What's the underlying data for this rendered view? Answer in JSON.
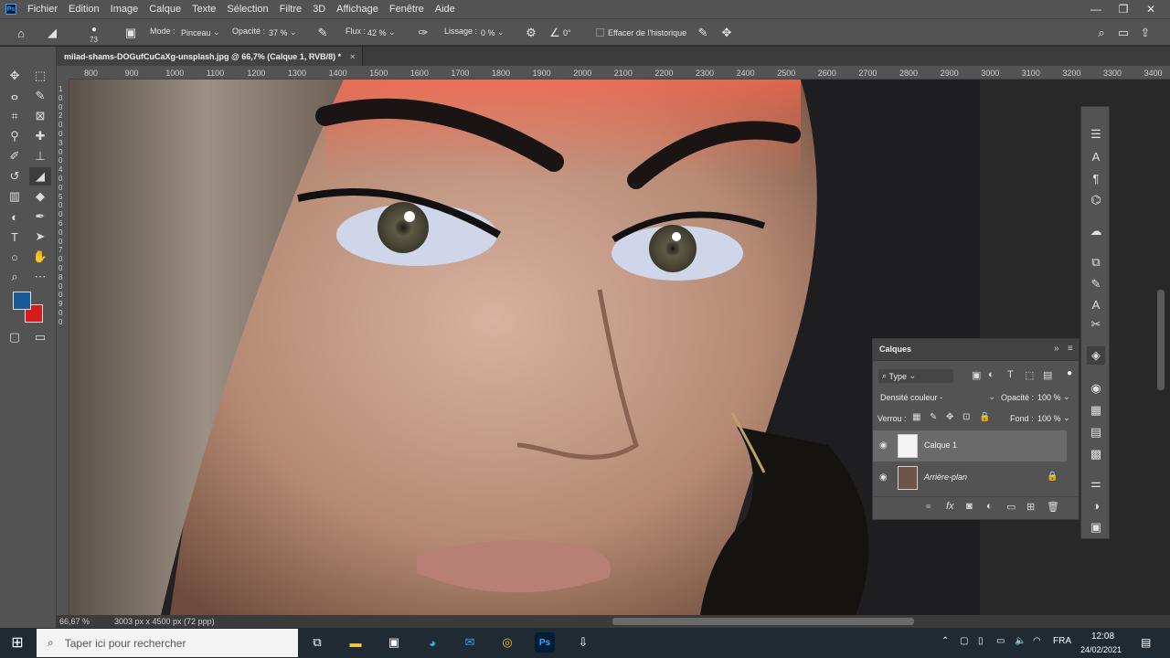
{
  "app": {
    "logo": "Ps"
  },
  "menu": [
    "Fichier",
    "Edition",
    "Image",
    "Calque",
    "Texte",
    "Sélection",
    "Filtre",
    "3D",
    "Affichage",
    "Fenêtre",
    "Aide"
  ],
  "window_controls": {
    "minimize": "—",
    "maximize": "❐",
    "close": "✕"
  },
  "options": {
    "brush_size": "73",
    "mode_label": "Mode :",
    "mode_value": "Pinceau",
    "opacity_label": "Opacité :",
    "opacity_value": "37 %",
    "flux_label": "Flux :",
    "flux_value": "42 %",
    "lissage_label": "Lissage :",
    "lissage_value": "0 %",
    "angle_value": "0°",
    "effacer_label": "Effacer de l'historique"
  },
  "document_tab": {
    "title": "milad-shams-DOGufCuCaXg-unsplash.jpg @ 66,7% (Calque 1, RVB/8) *",
    "close": "×"
  },
  "ruler_h": [
    "800",
    "900",
    "1000",
    "1100",
    "1200",
    "1300",
    "1400",
    "1500",
    "1600",
    "1700",
    "1800",
    "1900",
    "2000",
    "2100",
    "2200",
    "2300",
    "2400",
    "2500",
    "2600",
    "2700",
    "2800",
    "2900",
    "3000",
    "3100",
    "3200",
    "3300",
    "3400"
  ],
  "ruler_v": [
    "1",
    "0",
    "0",
    "2",
    "0",
    "0",
    "3",
    "0",
    "0",
    "4",
    "0",
    "0",
    "5",
    "0",
    "0",
    "6",
    "0",
    "0",
    "7",
    "0",
    "0",
    "8",
    "0",
    "0",
    "9",
    "0",
    "0"
  ],
  "status": {
    "zoom": "66,67 %",
    "size": "3003 px x 4500 px (72 ppp)"
  },
  "colors": {
    "foreground": "#1a5a96",
    "background": "#d41c1c"
  },
  "layers_panel": {
    "title": "Calques",
    "filter_label": "Type",
    "blend_mode": "Densité couleur",
    "opacity_label": "Opacité :",
    "opacity_value": "100 %",
    "lock_label": "Verrou :",
    "fill_label": "Fond :",
    "fill_value": "100 %",
    "layers": [
      {
        "name": "Calque 1",
        "selected": true
      },
      {
        "name": "Arrière-plan",
        "selected": false
      }
    ]
  },
  "taskbar": {
    "search_placeholder": "Taper ici pour rechercher",
    "language": "FRA",
    "time": "12:08",
    "date": "24/02/2021"
  }
}
